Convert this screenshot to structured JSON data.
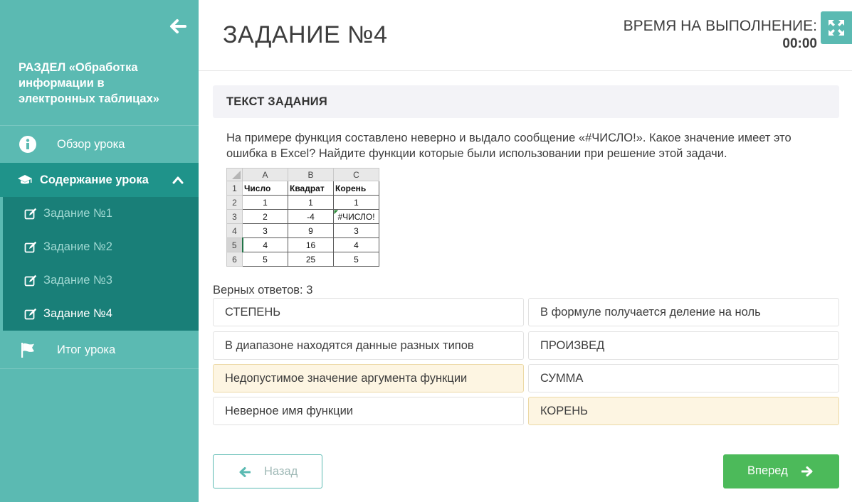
{
  "sidebar": {
    "section_title": "РАЗДЕЛ «Обработка информации в электронных таблицах»",
    "nav": {
      "overview": "Обзор урока",
      "content": "Содержание урока",
      "summary": "Итог урока"
    },
    "tasks": [
      "Задание №1",
      "Задание №2",
      "Задание №3",
      "Задание №4"
    ],
    "current_task": 3
  },
  "header": {
    "title": "ЗАДАНИЕ №4",
    "timer_label": "ВРЕМЯ НА ВЫПОЛНЕНИЕ:",
    "timer_value": "00:00"
  },
  "task": {
    "heading": "ТЕКСТ ЗАДАНИЯ",
    "text": "На примере функция составлено неверно и выдало сообщение «#ЧИСЛО!». Какое значение имеет это ошибка в Excel? Найдите функции которые были использовании при решение этой задачи.",
    "sheet": {
      "columns": [
        "A",
        "B",
        "C"
      ],
      "row_numbers": [
        "1",
        "2",
        "3",
        "4",
        "5",
        "6"
      ],
      "rows": [
        [
          "Число",
          "Квадрат",
          "Корень"
        ],
        [
          "1",
          "1",
          "1"
        ],
        [
          "2",
          "-4",
          "#ЧИСЛО!"
        ],
        [
          "3",
          "9",
          "3"
        ],
        [
          "4",
          "16",
          "4"
        ],
        [
          "5",
          "25",
          "5"
        ]
      ]
    },
    "answers_count": "Верных ответов: 3"
  },
  "options": [
    {
      "label": "СТЕПЕНЬ",
      "selected": false
    },
    {
      "label": "В формуле получается деление на ноль",
      "selected": false
    },
    {
      "label": "В диапазоне находятся данные разных типов",
      "selected": false
    },
    {
      "label": "ПРОИЗВЕД",
      "selected": false
    },
    {
      "label": "Недопустимое значение аргумента функции",
      "selected": true
    },
    {
      "label": "СУММА",
      "selected": false
    },
    {
      "label": "Неверное имя функции",
      "selected": false
    },
    {
      "label": "КОРЕНЬ",
      "selected": true
    }
  ],
  "buttons": {
    "back": "Назад",
    "next": "Вперед"
  },
  "colors": {
    "sidebar": "#5bbab2",
    "sidebar_active": "#1f938a",
    "submenu": "#197f78",
    "selected_option": "#fdf5e2",
    "next_button": "#4cba5a"
  },
  "icons": {
    "back": "arrow-left-icon",
    "overview": "info-icon",
    "content": "graduation-cap-icon",
    "collapse": "chevron-up-icon",
    "task": "edit-icon",
    "summary": "flag-icon",
    "fullscreen": "expand-icon",
    "prev": "arrow-left-icon",
    "next": "arrow-right-icon"
  }
}
